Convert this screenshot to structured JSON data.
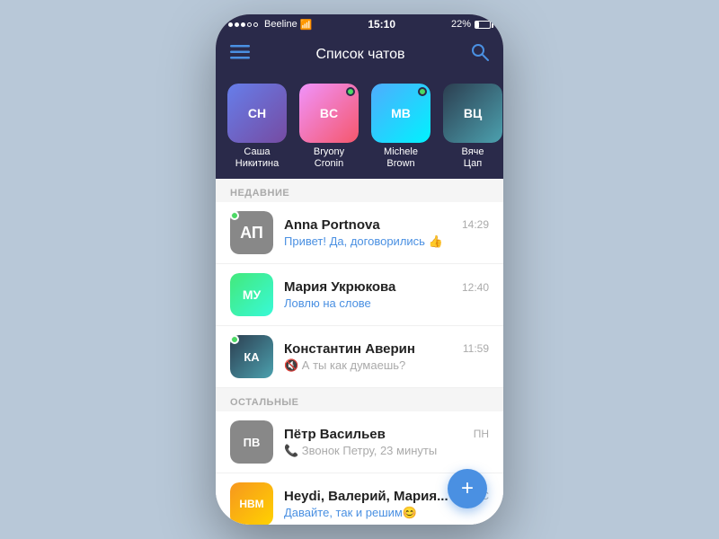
{
  "statusBar": {
    "carrier": "Beeline",
    "time": "15:10",
    "battery": "22%",
    "signal": "●●●○○"
  },
  "navBar": {
    "title": "Список чатов",
    "menuIcon": "☰",
    "searchIcon": "🔍"
  },
  "stories": [
    {
      "id": 1,
      "name": "Саша\nНикитина",
      "online": false,
      "bgClass": "bg-purple",
      "initials": "СН"
    },
    {
      "id": 2,
      "name": "Bryony\nCronin",
      "online": true,
      "bgClass": "bg-pink",
      "initials": "BC"
    },
    {
      "id": 3,
      "name": "Michele\nBrown",
      "online": true,
      "bgClass": "bg-blue",
      "initials": "MB"
    },
    {
      "id": 4,
      "name": "Вяче\nЦап",
      "online": false,
      "bgClass": "bg-dark",
      "initials": "ВЦ"
    }
  ],
  "sections": {
    "recent": "НЕДАВНИЕ",
    "others": "ОСТАЛЬНЫЕ"
  },
  "recentChats": [
    {
      "id": 1,
      "name": "Anna Portnova",
      "preview": "Привет! Да, договорились 👍",
      "time": "14:29",
      "online": true,
      "bgClass": "bg-gray",
      "initials": "AP"
    },
    {
      "id": 2,
      "name": "Мария Укрюкова",
      "preview": "Ловлю на слове",
      "time": "12:40",
      "online": false,
      "bgClass": "bg-green",
      "initials": "МУ"
    },
    {
      "id": 3,
      "name": "Константин Аверин",
      "preview": "🔇 А ты как думаешь?",
      "time": "11:59",
      "online": true,
      "bgClass": "bg-dark",
      "initials": "КА",
      "previewMuted": true
    }
  ],
  "otherChats": [
    {
      "id": 4,
      "name": "Пётр Васильев",
      "preview": "📞 Звонок Петру, 23 минуты",
      "time": "ПН",
      "online": false,
      "bgClass": "bg-gray",
      "initials": "ПВ",
      "previewMuted": true
    },
    {
      "id": 5,
      "name": "Heydi, Валерий, Мария...",
      "preview": "Давайте, так и решим😊",
      "time": "ВС",
      "online": false,
      "bgClass": "bg-orange",
      "initials": "HВМ"
    }
  ],
  "fab": {
    "icon": "+"
  }
}
